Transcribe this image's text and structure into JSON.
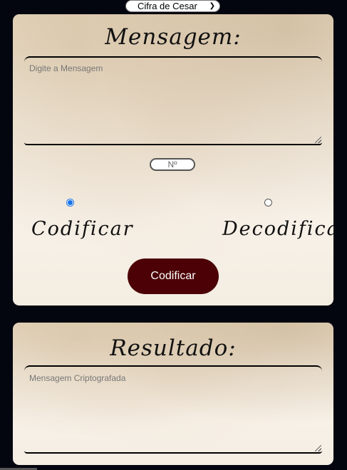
{
  "cipher_select": {
    "value": "Cifra de Cesar"
  },
  "message_card": {
    "title": "Mensagem:",
    "message_placeholder": "Digite a Mensagem",
    "number_placeholder": "Nº",
    "options": [
      {
        "label": "Codificar",
        "selected": true
      },
      {
        "label": "Decodificar",
        "selected": false
      }
    ],
    "action_button": "Codificar"
  },
  "result_card": {
    "title": "Resultado:",
    "result_placeholder": "Mensagem Criptografada"
  },
  "colors": {
    "page_background": "#03050f",
    "button_background": "#4b0105",
    "radio_accent": "#1a73e8"
  },
  "icons": [
    "chevron-down-icon",
    "resize-grip-icon"
  ]
}
